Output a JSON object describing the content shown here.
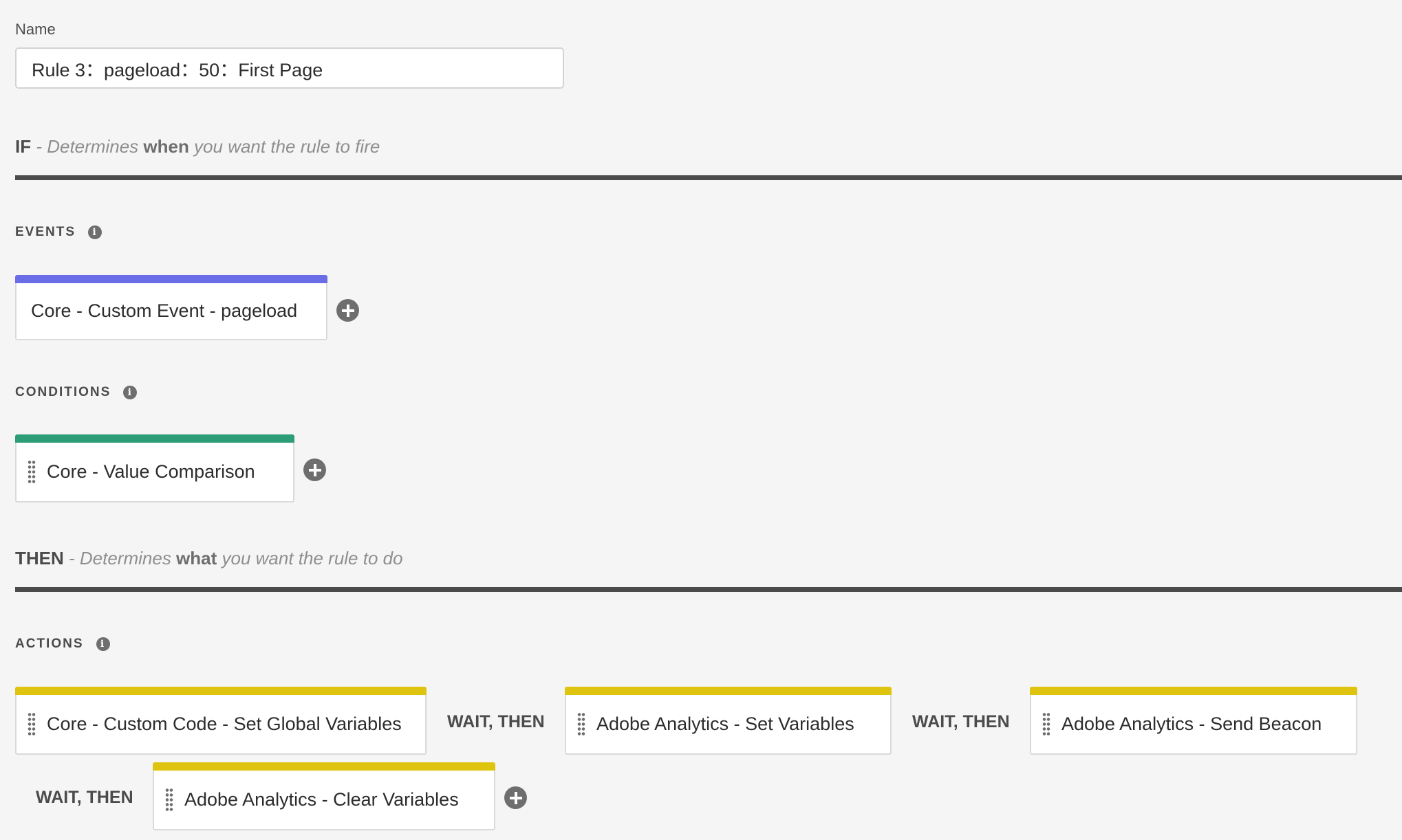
{
  "name_field": {
    "label": "Name",
    "value": "Rule 3：pageload：50：First Page"
  },
  "if_section": {
    "keyword": "IF",
    "pre": " - Determines ",
    "emphasis": "when",
    "post": " you want the rule to fire"
  },
  "then_section": {
    "keyword": "THEN",
    "pre": " - Determines ",
    "emphasis": "what",
    "post": " you want the rule to do"
  },
  "events": {
    "label": "EVENTS",
    "color": "#6b6de6",
    "items": [
      {
        "label": "Core - Custom Event - pageload"
      }
    ]
  },
  "conditions": {
    "label": "CONDITIONS",
    "color": "#2d9d78",
    "items": [
      {
        "label": "Core - Value Comparison"
      }
    ]
  },
  "actions": {
    "label": "ACTIONS",
    "color": "#dfc40f",
    "connector": "WAIT, THEN",
    "items": [
      {
        "label": "Core - Custom Code - Set Global Variables"
      },
      {
        "label": "Adobe Analytics - Set Variables"
      },
      {
        "label": "Adobe Analytics - Send Beacon"
      },
      {
        "label": "Adobe Analytics - Clear Variables"
      }
    ]
  },
  "icons": {
    "info": "info-icon",
    "add": "plus-circle-icon",
    "drag": "drag-handle-icon"
  }
}
